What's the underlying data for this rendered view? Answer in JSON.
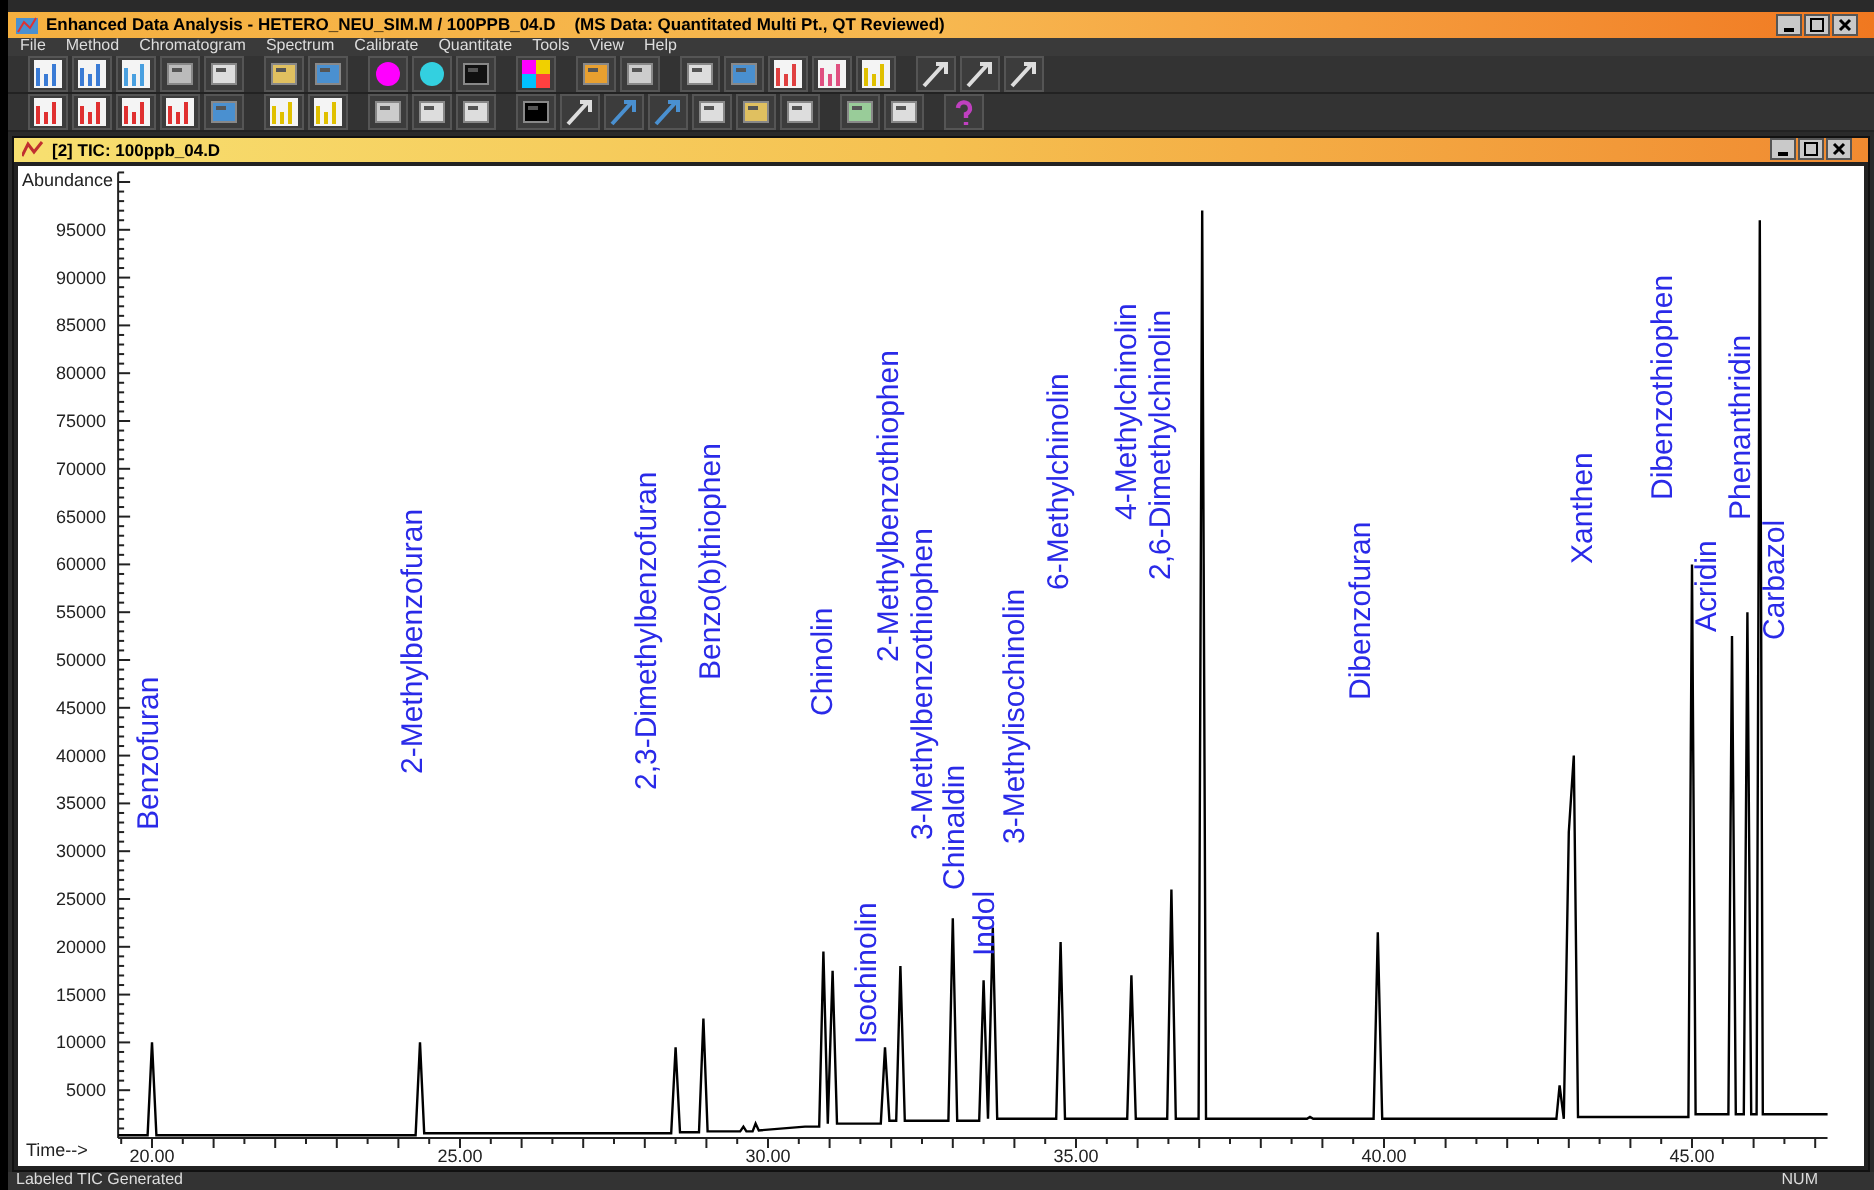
{
  "window": {
    "title": "Enhanced Data Analysis - HETERO_NEU_SIM.M / 100PPB_04.D    (MS Data: Quantitated Multi Pt., QT Reviewed)"
  },
  "menu": [
    "File",
    "Method",
    "Chromatogram",
    "Spectrum",
    "Calibrate",
    "Quantitate",
    "Tools",
    "View",
    "Help"
  ],
  "inner_window": {
    "title": "[2] TIC: 100ppb_04.D",
    "chart_data": {
      "type": "line",
      "ylabel": "Abundance",
      "xlabel": "Time-->",
      "xlim": [
        19.45,
        47.2
      ],
      "ylim": [
        0,
        101000
      ],
      "xticks": [
        {
          "value": 20,
          "label": "20.00"
        },
        {
          "value": 25,
          "label": "25.00"
        },
        {
          "value": 30,
          "label": "30.00"
        },
        {
          "value": 35,
          "label": "35.00"
        },
        {
          "value": 40,
          "label": "40.00"
        },
        {
          "value": 45,
          "label": "45.00"
        }
      ],
      "yticks": [
        5000,
        10000,
        15000,
        20000,
        25000,
        30000,
        35000,
        40000,
        45000,
        50000,
        55000,
        60000,
        65000,
        70000,
        75000,
        80000,
        85000,
        90000,
        95000
      ],
      "x": [
        19.45,
        19.93,
        20.0,
        20.07,
        24.28,
        24.35,
        24.42,
        28.43,
        28.5,
        28.57,
        28.88,
        28.95,
        29.02,
        29.55,
        29.6,
        29.65,
        29.75,
        29.8,
        29.85,
        30.6,
        30.83,
        30.9,
        30.97,
        31.05,
        31.12,
        31.83,
        31.9,
        31.97,
        32.08,
        32.15,
        32.22,
        32.93,
        33.0,
        33.07,
        33.43,
        33.5,
        33.57,
        33.65,
        33.72,
        34.68,
        34.75,
        34.82,
        35.83,
        35.9,
        35.97,
        36.48,
        36.55,
        36.62,
        36.99,
        37.05,
        37.11,
        38.75,
        38.8,
        38.85,
        39.83,
        39.9,
        39.97,
        42.8,
        42.85,
        42.92,
        43.0,
        43.08,
        43.15,
        44.94,
        45.0,
        45.06,
        45.59,
        45.65,
        45.71,
        45.84,
        45.9,
        45.96,
        46.05,
        46.1,
        46.15,
        47.2
      ],
      "series": [
        {
          "color": "#000000",
          "values": [
            300,
            300,
            10000,
            300,
            300,
            10000,
            500,
            500,
            9500,
            600,
            600,
            12500,
            700,
            700,
            1200,
            700,
            700,
            1500,
            800,
            1200,
            1200,
            19500,
            1500,
            17500,
            1500,
            1500,
            9500,
            1800,
            1800,
            18000,
            1800,
            1800,
            23000,
            1800,
            1800,
            16500,
            2000,
            22000,
            2000,
            2000,
            20500,
            2000,
            2000,
            17000,
            2000,
            2000,
            26000,
            2000,
            2000,
            97000,
            2000,
            2000,
            2200,
            2000,
            2000,
            21500,
            2000,
            2000,
            5500,
            2000,
            32000,
            40000,
            2200,
            2200,
            60000,
            2500,
            2500,
            52500,
            2500,
            2500,
            55000,
            2500,
            2500,
            96000,
            2500,
            2500
          ]
        }
      ],
      "annotations": [
        "Benzofuran",
        "2-Methylbenzofuran",
        "2,3-Dimethylbenzofuran",
        "Benzo(b)thiophen",
        "Chinolin",
        "Isochinolin",
        "2-Methylbenzothiophen",
        "3-Methylbenzothiophen",
        "Chinaldin",
        "Indol",
        "3-Methylisochinolin",
        "6-Methylchinolin",
        "4-Methylchinolin",
        "2,6-Dimethylchinolin",
        "Dibenzofuran",
        "Xanthen",
        "Dibenzothiophen",
        "Acridin",
        "Phenanthridin",
        "Carbazol"
      ]
    }
  },
  "status_bar": {
    "message": "Labeled TIC Generated",
    "indicator": "NUM"
  }
}
